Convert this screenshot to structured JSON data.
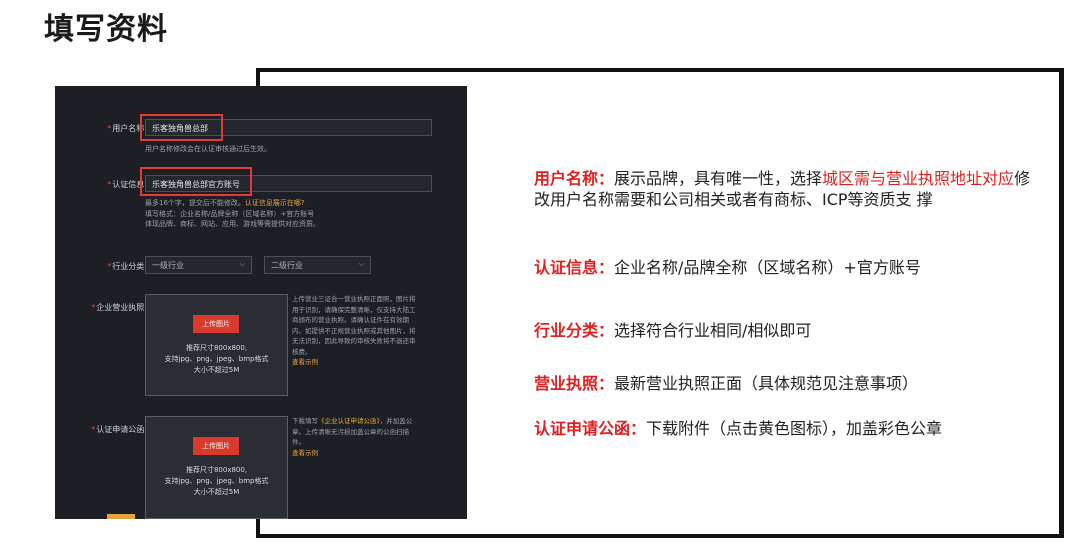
{
  "page_title": "填写资料",
  "form": {
    "username": {
      "label": "用户名称:",
      "value": "乐客独角兽总部",
      "hint": "用户名称修改会在认证审核通过后生效。"
    },
    "cert_info": {
      "label": "认证信息:",
      "value": "乐客独角兽总部官方账号",
      "hint_line1": "最多16个字，提交后不能修改。",
      "hint_link": "认证信息展示在哪?",
      "hint_line2": "填写格式：企业名称/品牌全称（区域名称）+官方账号",
      "hint_line3": "体现品牌、商标、网站、应用、游戏等需提供对应资质。"
    },
    "industry": {
      "label": "行业分类:",
      "primary_placeholder": "一级行业",
      "secondary_placeholder": "二级行业"
    },
    "license": {
      "label": "企业营业执照:",
      "upload_button": "上传图片",
      "size_text": "推荐尺寸800x800,",
      "format_text": "支持jpg、png、jpeg、bmp格式",
      "limit_text": "大小不超过5M",
      "note": "上传营业三证合一营业执照正面照，图片将用于识别，请确保完整清晰，仅支持大陆工商颁布的营业执照。请确认证件在有效期内。如提供不正规营业执照或其他图片，将无法识别，因此导致的审核失败将不退还审核费。",
      "note_link": "查看示例"
    },
    "announcement": {
      "label": "认证申请公函:",
      "upload_button": "上传图片",
      "size_text": "推荐尺寸800x800,",
      "format_text": "支持jpg、png、jpeg、bmp格式",
      "limit_text": "大小不超过5M",
      "note_prefix": "下载填写",
      "note_doc": "《企业认证申请公函》",
      "note_rest": "，并加盖公章。上传清晰无污损加盖公章的公函扫描件。",
      "note_link": "查看示例"
    }
  },
  "descriptions": [
    {
      "key": "用户名称",
      "colon": "：",
      "text_before": "展示品牌，具有唯一性，选择",
      "text_red": "城区需与营业执照地址对应",
      "text_after": "修改用户名称需要和公司相关或者有商标、ICP等资质支 撑"
    },
    {
      "key": "认证信息",
      "colon": "：",
      "text": "企业名称/品牌全称（区域名称）+官方账号"
    },
    {
      "key": "行业分类",
      "colon": "：",
      "text": "选择符合行业相同/相似即可"
    },
    {
      "key": "营业执照",
      "colon": "：",
      "text": "最新营业执照正面（具体规范见注意事项）"
    },
    {
      "key": "认证申请公函",
      "colon": "：",
      "text": "下载附件（点击黄色图标），加盖彩色公章"
    }
  ],
  "colors": {
    "accent_red": "#e02020",
    "dark_panel": "#1d1f24",
    "link_orange": "#e6a23c"
  }
}
